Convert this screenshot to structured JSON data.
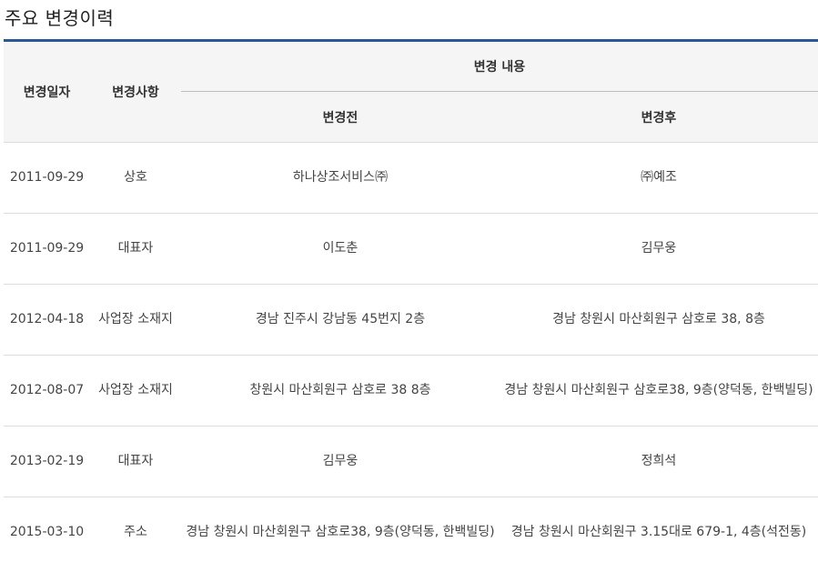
{
  "title": "주요 변경이력",
  "table": {
    "headers": {
      "date": "변경일자",
      "item": "변경사항",
      "content": "변경 내용",
      "before": "변경전",
      "after": "변경후"
    },
    "rows": [
      {
        "date": "2011-09-29",
        "item": "상호",
        "before": "하나상조서비스㈜",
        "after": "㈜예조"
      },
      {
        "date": "2011-09-29",
        "item": "대표자",
        "before": "이도춘",
        "after": "김무웅"
      },
      {
        "date": "2012-04-18",
        "item": "사업장 소재지",
        "before": "경남 진주시 강남동 45번지 2층",
        "after": "경남 창원시 마산회원구 삼호로 38, 8층"
      },
      {
        "date": "2012-08-07",
        "item": "사업장 소재지",
        "before": "창원시 마산회원구 삼호로 38 8층",
        "after": "경남 창원시 마산회원구 삼호로38, 9층(양덕동, 한백빌딩)"
      },
      {
        "date": "2013-02-19",
        "item": "대표자",
        "before": "김무웅",
        "after": "정희석"
      },
      {
        "date": "2015-03-10",
        "item": "주소",
        "before": "경남 창원시 마산회원구 삼호로38, 9층(양덕동, 한백빌딩)",
        "after": "경남 창원시 마산회원구 3.15대로 679-1, 4층(석전동)"
      }
    ]
  }
}
